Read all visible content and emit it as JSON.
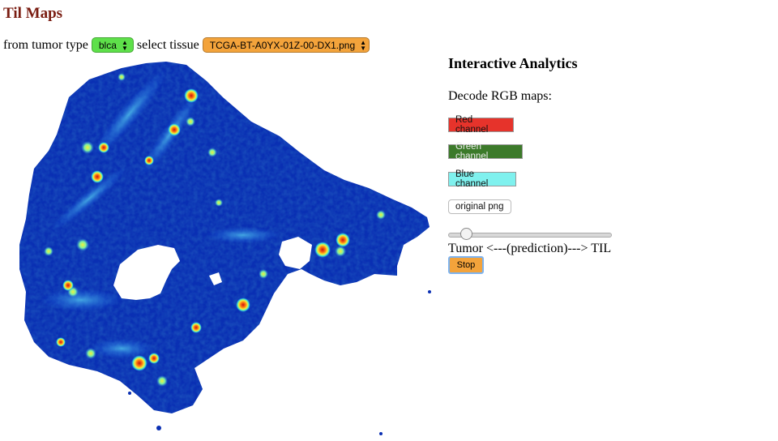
{
  "page": {
    "title": "Til Maps"
  },
  "selectors": {
    "tumor_label": "from tumor type",
    "tumor_value": "blca",
    "tissue_label": "select tissue",
    "tissue_value": "TCGA-BT-A0YX-01Z-00-DX1.png"
  },
  "analytics": {
    "heading": "Interactive Analytics",
    "decode_label": "Decode RGB maps:",
    "buttons": {
      "red": "Red channel",
      "green": "Green channel",
      "blue": "Blue channel",
      "original": "original png"
    },
    "prediction_label": "Tumor <---(prediction)---> TIL",
    "stop": "Stop",
    "slider_value_fraction": 0.08
  },
  "colors": {
    "title": "#7a1d12",
    "tumor_select": "#5ee04a",
    "tissue_select": "#f3a33b",
    "red_channel": "#e6332b",
    "green_channel": "#3c7a2a",
    "blue_channel": "#7ff1ee",
    "stop_button": "#f3a33b",
    "heatmap_background": "#0a2fb3"
  },
  "icons": {
    "select_arrows": "up-down-arrows-icon"
  }
}
